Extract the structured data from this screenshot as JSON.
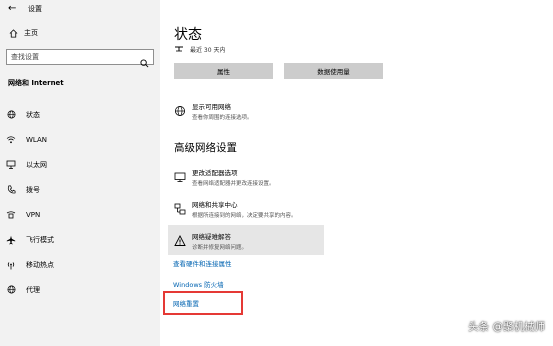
{
  "window": {
    "back_icon": "back-arrow-icon",
    "title": "设置"
  },
  "sidebar": {
    "home": {
      "icon": "home-icon",
      "label": "主页"
    },
    "search": {
      "placeholder": "查找设置",
      "icon": "search-icon"
    },
    "section_title": "网络和 Internet",
    "items": [
      {
        "icon": "globe-icon",
        "label": "状态"
      },
      {
        "icon": "wifi-icon",
        "label": "WLAN"
      },
      {
        "icon": "ethernet-icon",
        "label": "以太网"
      },
      {
        "icon": "dialup-icon",
        "label": "拨号"
      },
      {
        "icon": "vpn-icon",
        "label": "VPN"
      },
      {
        "icon": "airplane-icon",
        "label": "飞行模式"
      },
      {
        "icon": "hotspot-icon",
        "label": "移动热点"
      },
      {
        "icon": "proxy-icon",
        "label": "代理"
      }
    ]
  },
  "main": {
    "title": "状态",
    "status_text": "最近 30 天内",
    "buttons": {
      "properties": "属性",
      "data_usage": "数据使用量"
    },
    "show_networks": {
      "icon": "network-globe-icon",
      "title": "显示可用网络",
      "desc": "查看你周围的连接选项。"
    },
    "advanced_heading": "高级网络设置",
    "adapter": {
      "icon": "monitor-adapter-icon",
      "title": "更改适配器选项",
      "desc": "查看网络适配器并更改连接设置。"
    },
    "sharing": {
      "icon": "sharing-center-icon",
      "title": "网络和共享中心",
      "desc": "根据所连接到的网络，决定要共享的内容。"
    },
    "troubleshoot": {
      "icon": "warning-icon",
      "title": "网络疑难解答",
      "desc": "诊断并修复网络问题。"
    },
    "links": {
      "hardware": "查看硬件和连接属性",
      "firewall": "Windows 防火墙",
      "reset": "网络重置"
    }
  },
  "watermark": "头条 @聚机械师",
  "colors": {
    "link": "#0063b1",
    "highlight": "#e53935",
    "sidebar_bg": "#f2f2f2",
    "button_bg": "#cccccc"
  }
}
